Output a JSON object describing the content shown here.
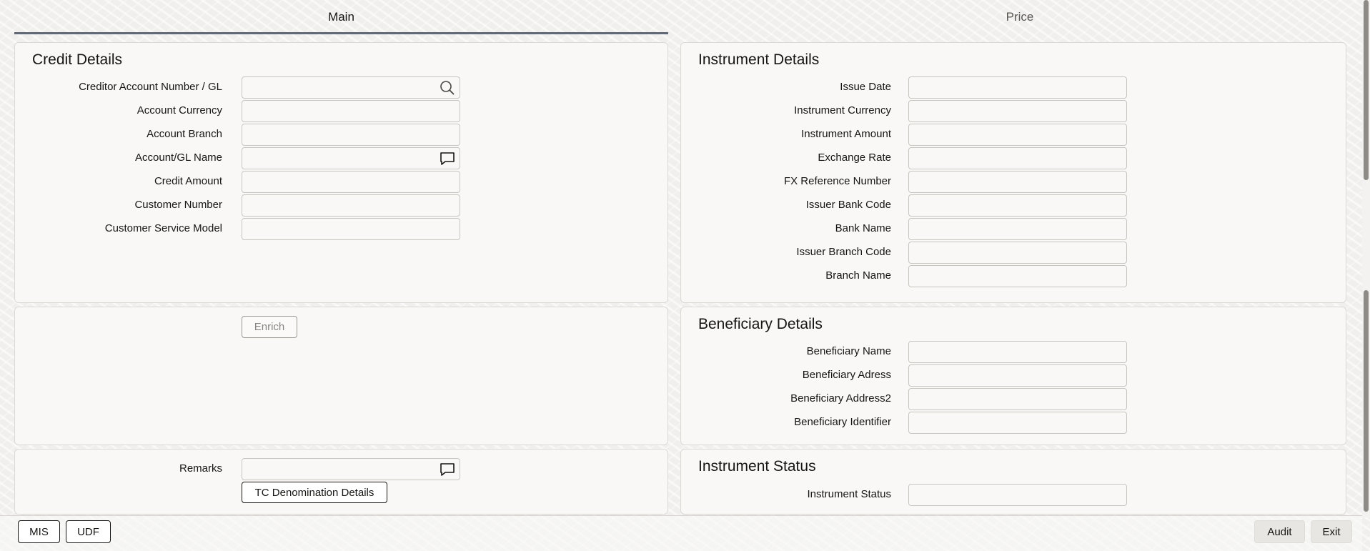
{
  "tabs": {
    "main": "Main",
    "price": "Price"
  },
  "credit_details": {
    "title": "Credit Details",
    "fields": {
      "creditor_account": {
        "label": "Creditor Account Number / GL",
        "value": ""
      },
      "account_currency": {
        "label": "Account Currency",
        "value": ""
      },
      "account_branch": {
        "label": "Account Branch",
        "value": ""
      },
      "account_gl_name": {
        "label": "Account/GL Name",
        "value": ""
      },
      "credit_amount": {
        "label": "Credit Amount",
        "value": ""
      },
      "customer_number": {
        "label": "Customer Number",
        "value": ""
      },
      "customer_service_model": {
        "label": "Customer Service Model",
        "value": ""
      }
    }
  },
  "enrich": {
    "button_label": "Enrich"
  },
  "remarks": {
    "label": "Remarks",
    "value": "",
    "tc_button_label": "TC Denomination Details"
  },
  "instrument_details": {
    "title": "Instrument Details",
    "fields": {
      "issue_date": {
        "label": "Issue Date",
        "value": ""
      },
      "instrument_currency": {
        "label": "Instrument Currency",
        "value": ""
      },
      "instrument_amount": {
        "label": "Instrument Amount",
        "value": ""
      },
      "exchange_rate": {
        "label": "Exchange Rate",
        "value": ""
      },
      "fx_reference_number": {
        "label": "FX Reference Number",
        "value": ""
      },
      "issuer_bank_code": {
        "label": "Issuer Bank Code",
        "value": ""
      },
      "bank_name": {
        "label": "Bank Name",
        "value": ""
      },
      "issuer_branch_code": {
        "label": "Issuer Branch Code",
        "value": ""
      },
      "branch_name": {
        "label": "Branch Name",
        "value": ""
      }
    }
  },
  "beneficiary_details": {
    "title": "Beneficiary Details",
    "fields": {
      "beneficiary_name": {
        "label": "Beneficiary Name",
        "value": ""
      },
      "beneficiary_adress": {
        "label": "Beneficiary Adress",
        "value": ""
      },
      "beneficiary_address2": {
        "label": "Beneficiary Address2",
        "value": ""
      },
      "beneficiary_identifier": {
        "label": "Beneficiary Identifier",
        "value": ""
      }
    }
  },
  "instrument_status": {
    "title": "Instrument Status",
    "fields": {
      "instrument_status": {
        "label": "Instrument Status",
        "value": ""
      }
    }
  },
  "footer": {
    "mis_label": "MIS",
    "udf_label": "UDF",
    "audit_label": "Audit",
    "exit_label": "Exit"
  },
  "icons": {
    "lookup": "search-icon",
    "comment": "speech-bubble-icon"
  }
}
